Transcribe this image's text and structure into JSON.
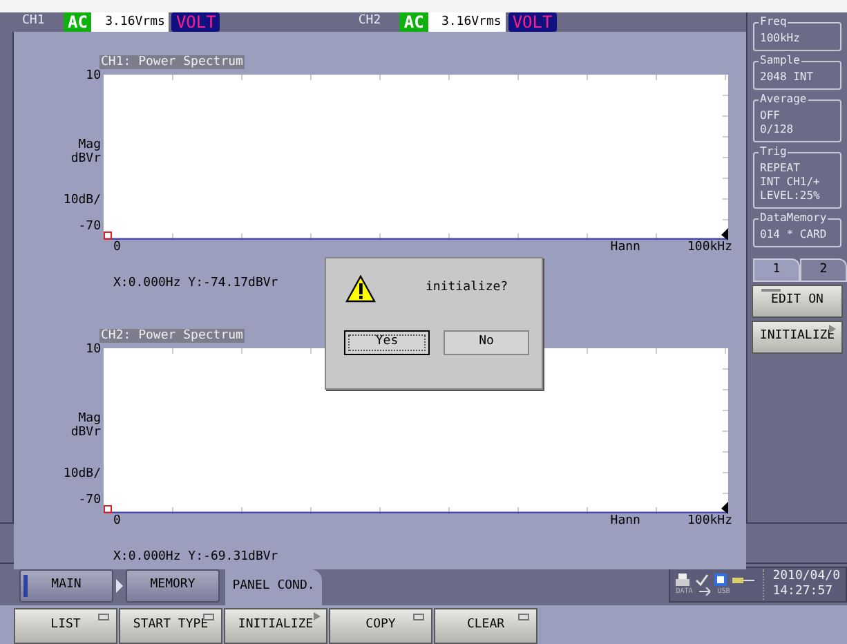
{
  "header": {
    "channels": [
      {
        "name": "CH1",
        "coupling": "AC",
        "range": "3.16Vrms",
        "unit": "VOLT"
      },
      {
        "name": "CH2",
        "coupling": "AC",
        "range": "3.16Vrms",
        "unit": "VOLT"
      }
    ]
  },
  "charts": [
    {
      "title": "CH1: Power Spectrum",
      "ytop": "10",
      "ylabel": [
        "Mag",
        "dBVr"
      ],
      "yscale": "10dB/",
      "ybottom": "-70",
      "xleft": "0",
      "window": "Hann",
      "xright": "100kHz",
      "cursor": "X:0.000Hz Y:-74.17dBVr"
    },
    {
      "title": "CH2: Power Spectrum",
      "ytop": "10",
      "ylabel": [
        "Mag",
        "dBVr"
      ],
      "yscale": "10dB/",
      "ybottom": "-70",
      "xleft": "0",
      "window": "Hann",
      "xright": "100kHz",
      "cursor": "X:0.000Hz Y:-69.31dBVr"
    }
  ],
  "dialog": {
    "message": "initialize?",
    "buttons": [
      {
        "label": "Yes",
        "selected": true
      },
      {
        "label": "No",
        "selected": false
      }
    ]
  },
  "sidebar": {
    "groups": [
      {
        "title": "Freq",
        "lines": [
          "100kHz"
        ]
      },
      {
        "title": "Sample",
        "lines": [
          "2048 INT"
        ]
      },
      {
        "title": "Average",
        "lines": [
          "OFF",
          "0/128"
        ]
      },
      {
        "title": "Trig",
        "lines": [
          "REPEAT",
          "INT CH1/+",
          "LEVEL:25%"
        ]
      },
      {
        "title": "DataMemory",
        "lines": [
          "014 * CARD"
        ]
      }
    ],
    "tabs": [
      {
        "label": "1",
        "selected": true
      },
      {
        "label": "2",
        "selected": false
      }
    ],
    "buttons": [
      {
        "label": "EDIT ON",
        "kind": "toggle"
      },
      {
        "label": "INITIALIZE",
        "kind": "submenu"
      }
    ]
  },
  "nav_tabs": [
    {
      "label": "MAIN",
      "selected": false
    },
    {
      "label": "MEMORY",
      "selected": false
    },
    {
      "label": "PANEL COND.",
      "selected": true
    }
  ],
  "status": {
    "icon_labels": [
      "DATA",
      "USB"
    ],
    "date": "2010/04/0",
    "time": "14:27:57"
  },
  "function_keys": [
    {
      "label": "LIST",
      "kind": "menu"
    },
    {
      "label": "START TYPE",
      "kind": "menu"
    },
    {
      "label": "INITIALIZE",
      "kind": "submenu"
    },
    {
      "label": "COPY",
      "kind": "menu"
    },
    {
      "label": "CLEAR",
      "kind": "menu"
    }
  ]
}
